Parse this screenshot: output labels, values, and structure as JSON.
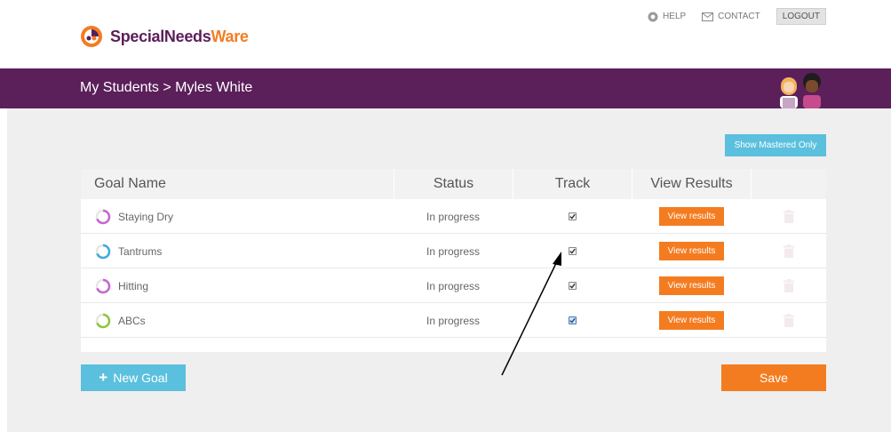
{
  "header": {
    "logo_primary": "SpecialNeeds",
    "logo_accent": "Ware",
    "help": "HELP",
    "contact": "CONTACT",
    "logout": "LOGOUT"
  },
  "banner": {
    "breadcrumb": "My Students > Myles White"
  },
  "toolbar": {
    "show_mastered": "Show Mastered Only"
  },
  "table": {
    "columns": [
      "Goal Name",
      "Status",
      "Track",
      "View Results"
    ],
    "rows": [
      {
        "goal": "Staying Dry",
        "status": "In progress",
        "tracked": true,
        "view": "View results",
        "ring_color": "#c864d2"
      },
      {
        "goal": "Tantrums",
        "status": "In progress",
        "tracked": true,
        "view": "View results",
        "ring_color": "#3fa9e0"
      },
      {
        "goal": "Hitting",
        "status": "In progress",
        "tracked": true,
        "view": "View results",
        "ring_color": "#c864d2"
      },
      {
        "goal": "ABCs",
        "status": "In progress",
        "tracked": true,
        "view": "View results",
        "ring_color": "#8cc63f"
      }
    ]
  },
  "actions": {
    "new_goal": "New Goal",
    "save": "Save"
  },
  "colors": {
    "brand_purple": "#5b1f5a",
    "accent_orange": "#f47c20",
    "accent_blue": "#5bc0de"
  }
}
